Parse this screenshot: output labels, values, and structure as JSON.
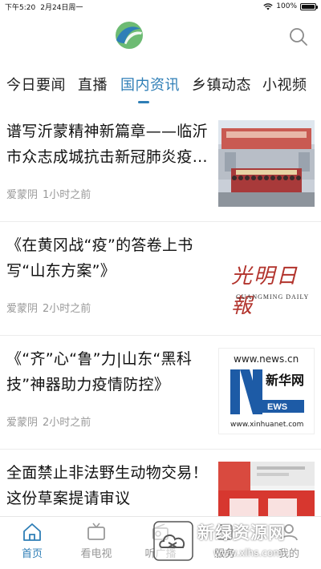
{
  "status_bar": {
    "time": "下午5:20",
    "date": "2月24日周一",
    "battery": "100%",
    "battery_level": 1.0
  },
  "header": {
    "logo_icon": "app-logo-icon",
    "search_icon": "search-icon"
  },
  "tabs": [
    {
      "label": "今日要闻",
      "active": false
    },
    {
      "label": "直播",
      "active": false
    },
    {
      "label": "国内资讯",
      "active": true
    },
    {
      "label": "乡镇动态",
      "active": false
    },
    {
      "label": "小视频",
      "active": false
    }
  ],
  "news": [
    {
      "title": "谱写沂蒙精神新篇章——临沂市众志成城抗击新冠肺炎疫…",
      "author": "爱蒙阴",
      "time": "1小时之前",
      "thumb": "group-photo"
    },
    {
      "title": "《在黄冈战“疫”的答卷上书写“山东方案”》",
      "author": "爱蒙阴",
      "time": "2小时之前",
      "thumb": "guangming-daily",
      "thumb_text": "光明日報",
      "thumb_sub": "GUANGMING DAILY"
    },
    {
      "title": "《“齐”心“鲁”力|山东“黑科技”神器助力疫情防控》",
      "author": "爱蒙阴",
      "time": "2小时之前",
      "thumb": "xinhua-news",
      "thumb_text": "www.news.cn",
      "thumb_brand": "新华网",
      "thumb_sub": "www.xinhuanet.com"
    },
    {
      "title": "全面禁止非法野生动物交易！这份草案提请审议",
      "author": "",
      "time": "",
      "thumb": "newspaper"
    }
  ],
  "tabbar": [
    {
      "label": "首页",
      "icon": "home-icon",
      "active": true
    },
    {
      "label": "看电视",
      "icon": "tv-icon",
      "active": false
    },
    {
      "label": "听广播",
      "icon": "radio-icon",
      "active": false
    },
    {
      "label": "服务",
      "icon": "service-icon",
      "active": false
    },
    {
      "label": "我的",
      "icon": "user-icon",
      "active": false
    }
  ],
  "watermark": {
    "text": "新绿资源网",
    "url": "www.xlhs.com"
  },
  "colors": {
    "accent": "#2e7eb6",
    "logo_green": "#6dbb73",
    "logo_blue": "#2f7fb7"
  }
}
